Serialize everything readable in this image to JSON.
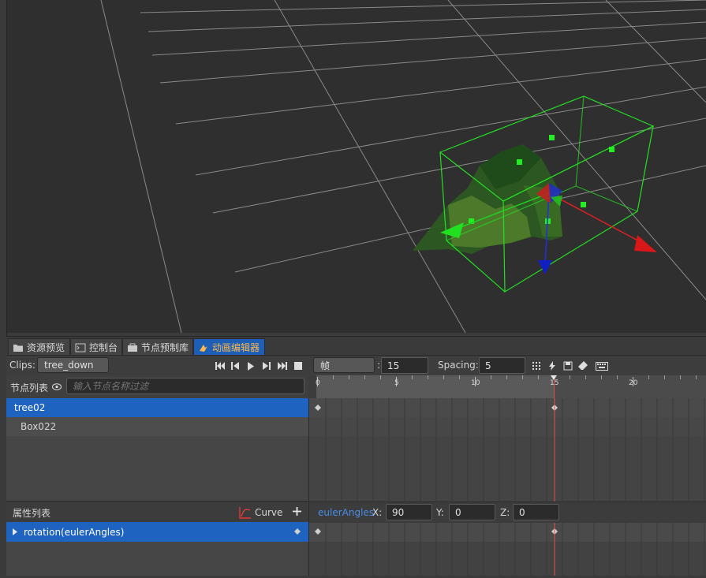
{
  "tabs": [
    {
      "label": "资源预览",
      "icon": "folder-icon"
    },
    {
      "label": "控制台",
      "icon": "console-icon"
    },
    {
      "label": "节点预制库",
      "icon": "prefab-icon"
    },
    {
      "label": "动画编辑器",
      "icon": "animation-icon",
      "active": true
    }
  ],
  "toolbar": {
    "clips_label": "Clips:",
    "clip_value": "tree_down",
    "unit_value": "帧",
    "frame_value": "15",
    "spacing_label": "Spacing:",
    "spacing_value": "5",
    "colon": ":"
  },
  "node_list": {
    "title": "节点列表",
    "filter_placeholder": "输入节点名称过滤",
    "items": [
      {
        "label": "tree02",
        "selected": true
      },
      {
        "label": "Box022",
        "selected": false
      }
    ]
  },
  "timeline": {
    "ticks": [
      {
        "frame": 0,
        "label": "0"
      },
      {
        "frame": 5,
        "label": "5"
      },
      {
        "frame": 10,
        "label": "10"
      },
      {
        "frame": 15,
        "label": "15"
      },
      {
        "frame": 20,
        "label": "20"
      }
    ],
    "current_frame": 15,
    "keyframes": [
      0,
      15
    ],
    "playhead_color": "#e05050"
  },
  "property_list": {
    "title": "属性列表",
    "curve_label": "Curve",
    "items": [
      {
        "label": "rotation(eulerAngles)"
      }
    ]
  },
  "euler": {
    "name": "eulerAngles",
    "x_label": "X:",
    "x_value": "90",
    "y_label": "Y:",
    "y_value": "0",
    "z_label": "Z:",
    "z_value": "0"
  }
}
